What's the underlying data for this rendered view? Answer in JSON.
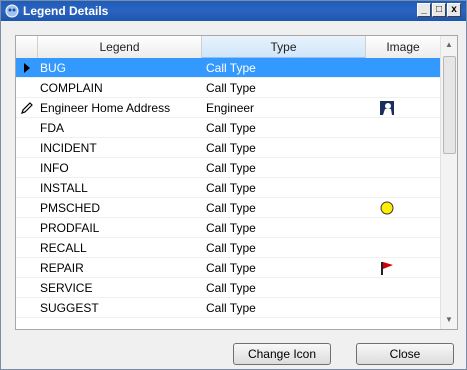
{
  "window": {
    "title": "Legend Details",
    "minimize_icon": "minimize-icon",
    "restore_icon": "restore-icon",
    "close_icon": "close-icon"
  },
  "grid": {
    "columns": [
      "Legend",
      "Type",
      "Image"
    ],
    "rows": [
      {
        "legend": "BUG",
        "type": "Call Type",
        "image": "",
        "indicator": "current-row-arrow-icon",
        "selected": true
      },
      {
        "legend": "COMPLAIN",
        "type": "Call Type",
        "image": "",
        "indicator": "",
        "selected": false
      },
      {
        "legend": "Engineer Home Address",
        "type": "Engineer",
        "image": "engineer-icon",
        "indicator": "edit-pencil-icon",
        "selected": false
      },
      {
        "legend": "FDA",
        "type": "Call Type",
        "image": "",
        "indicator": "",
        "selected": false
      },
      {
        "legend": "INCIDENT",
        "type": "Call Type",
        "image": "",
        "indicator": "",
        "selected": false
      },
      {
        "legend": "INFO",
        "type": "Call Type",
        "image": "",
        "indicator": "",
        "selected": false
      },
      {
        "legend": "INSTALL",
        "type": "Call Type",
        "image": "",
        "indicator": "",
        "selected": false
      },
      {
        "legend": "PMSCHED",
        "type": "Call Type",
        "image": "yellow-circle-icon",
        "indicator": "",
        "selected": false
      },
      {
        "legend": "PRODFAIL",
        "type": "Call Type",
        "image": "",
        "indicator": "",
        "selected": false
      },
      {
        "legend": "RECALL",
        "type": "Call Type",
        "image": "",
        "indicator": "",
        "selected": false
      },
      {
        "legend": "REPAIR",
        "type": "Call Type",
        "image": "red-flag-icon",
        "indicator": "",
        "selected": false
      },
      {
        "legend": "SERVICE",
        "type": "Call Type",
        "image": "",
        "indicator": "",
        "selected": false
      },
      {
        "legend": "SUGGEST",
        "type": "Call Type",
        "image": "",
        "indicator": "",
        "selected": false
      }
    ]
  },
  "buttons": {
    "change_icon": "Change Icon",
    "close": "Close"
  },
  "colors": {
    "titlebar": "#2a63c0",
    "selection": "#3399ff",
    "yellow": "#ffee00",
    "red": "#d40000"
  }
}
